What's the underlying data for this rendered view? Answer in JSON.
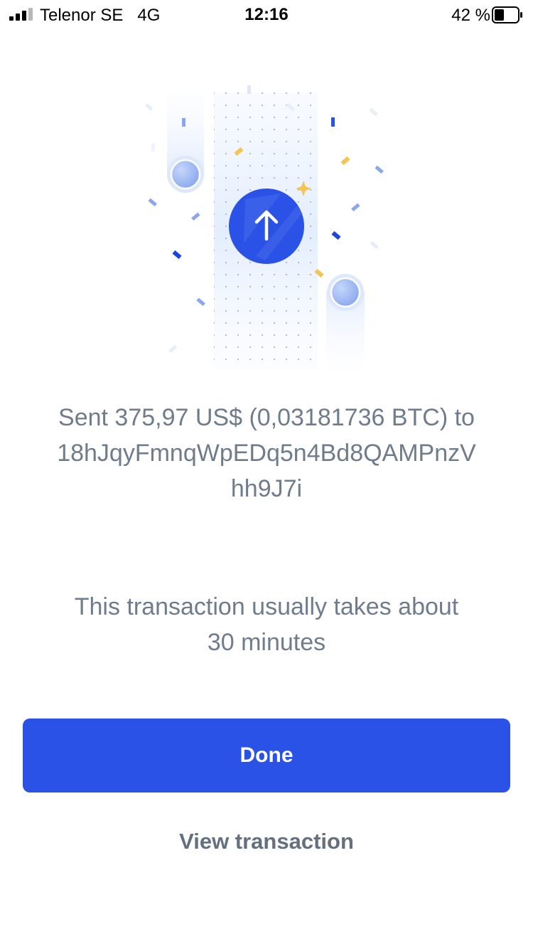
{
  "status_bar": {
    "carrier": "Telenor SE",
    "network": "4G",
    "time": "12:16",
    "battery_percent": "42 %",
    "battery_level": 0.42
  },
  "confirmation": {
    "message": "Sent 375,97 US$ (0,03181736 BTC) to 18hJqyFmnqWpEDq5n4Bd8QAMPnzVhh9J7i",
    "hint": "This transaction usually takes about 30 minutes"
  },
  "actions": {
    "done_label": "Done",
    "view_transaction_label": "View transaction"
  },
  "colors": {
    "accent": "#2a52e6",
    "text_muted": "#6f7c8c",
    "confetti_gold": "#f4c554",
    "confetti_blue": "#2a52e6"
  },
  "icons": {
    "send_icon": "arrow-up-icon",
    "signal_icon": "signal-bars-icon",
    "battery_icon": "battery-icon"
  }
}
